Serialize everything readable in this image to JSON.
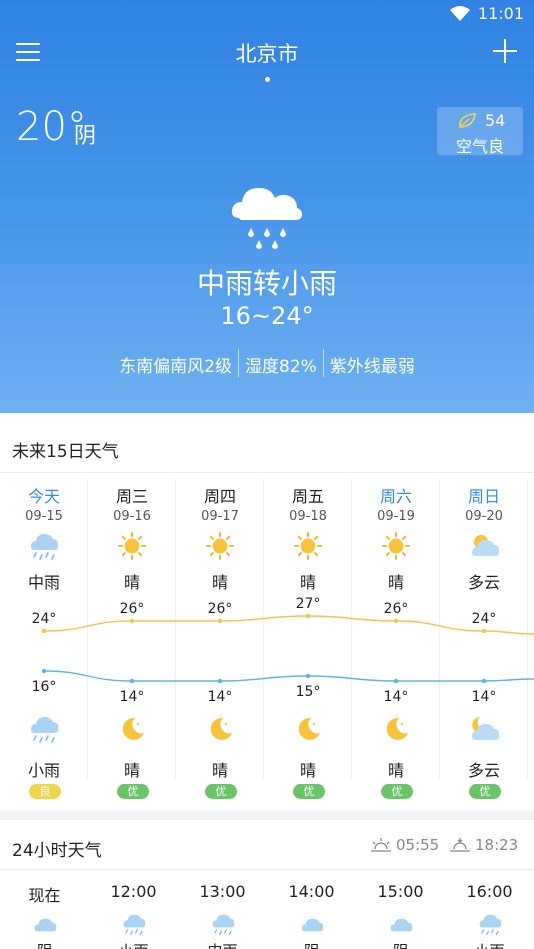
{
  "status_bar": {
    "time": "11:01"
  },
  "header": {
    "city": "北京市"
  },
  "current": {
    "temp": "20°",
    "condition": "阴",
    "aqi_value": "54",
    "aqi_label": "空气良",
    "description": "中雨转小雨",
    "range": "16~24°",
    "wind": "东南偏南风2级",
    "humidity": "湿度82%",
    "uv": "紫外线最弱"
  },
  "forecast15": {
    "title": "未来15日天气",
    "days": [
      {
        "day": "今天",
        "date": "09-15",
        "day_cond": "中雨",
        "day_icon": "rain-cloud-icon",
        "high": "24°",
        "low": "16°",
        "night_icon": "rain-cloud-icon",
        "night_cond": "小雨",
        "aq": "良",
        "highlight": true
      },
      {
        "day": "周三",
        "date": "09-16",
        "day_cond": "晴",
        "day_icon": "sun-icon",
        "high": "26°",
        "low": "14°",
        "night_icon": "moon-icon",
        "night_cond": "晴",
        "aq": "优",
        "highlight": false
      },
      {
        "day": "周四",
        "date": "09-17",
        "day_cond": "晴",
        "day_icon": "sun-icon",
        "high": "26°",
        "low": "14°",
        "night_icon": "moon-icon",
        "night_cond": "晴",
        "aq": "优",
        "highlight": false
      },
      {
        "day": "周五",
        "date": "09-18",
        "day_cond": "晴",
        "day_icon": "sun-icon",
        "high": "27°",
        "low": "15°",
        "night_icon": "moon-icon",
        "night_cond": "晴",
        "aq": "优",
        "highlight": false
      },
      {
        "day": "周六",
        "date": "09-19",
        "day_cond": "晴",
        "day_icon": "sun-icon",
        "high": "26°",
        "low": "14°",
        "night_icon": "moon-icon",
        "night_cond": "晴",
        "aq": "优",
        "highlight": true
      },
      {
        "day": "周日",
        "date": "09-20",
        "day_cond": "多云",
        "day_icon": "partly-cloudy-icon",
        "high": "24°",
        "low": "14°",
        "night_icon": "partly-cloudy-night-icon",
        "night_cond": "多云",
        "aq": "优",
        "highlight": true
      }
    ],
    "colors": {
      "high_line": "#f5c244",
      "low_line": "#5bb5e8",
      "aq_good": "#f0d44a",
      "aq_excellent": "#6cc46a",
      "highlight": "#2f8ae8"
    }
  },
  "hourly24": {
    "title": "24小时天气",
    "sunrise": "05:55",
    "sunset": "18:23",
    "hours": [
      {
        "time": "现在",
        "icon": "cloud-icon",
        "cond": "阴"
      },
      {
        "time": "12:00",
        "icon": "rain-cloud-icon",
        "cond": "小雨"
      },
      {
        "time": "13:00",
        "icon": "rain-cloud-icon",
        "cond": "中雨"
      },
      {
        "time": "14:00",
        "icon": "cloud-icon",
        "cond": "阴"
      },
      {
        "time": "15:00",
        "icon": "cloud-icon",
        "cond": "阴"
      },
      {
        "time": "16:00",
        "icon": "rain-cloud-icon",
        "cond": "小雨"
      }
    ]
  }
}
